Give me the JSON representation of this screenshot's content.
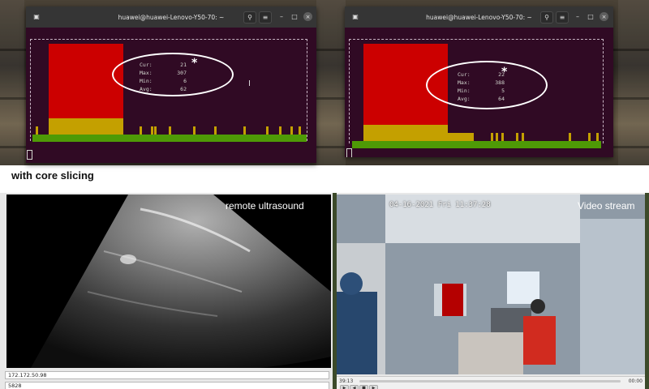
{
  "terminals": [
    {
      "title": "huawei@huawei-Lenovo-Y50-70: ~",
      "stats": {
        "cur_label": "Cur:",
        "cur": "21",
        "max_label": "Max:",
        "max": "307",
        "min_label": "Min:",
        "min": "6",
        "avg_label": "Avg:",
        "avg": "62"
      },
      "marker": "*"
    },
    {
      "title": "huawei@huawei-Lenovo-Y50-70: ~",
      "stats": {
        "cur_label": "Cur:",
        "cur": "22",
        "max_label": "Max:",
        "max": "388",
        "min_label": "Min:",
        "min": "5",
        "avg_label": "Avg:",
        "avg": "64"
      },
      "marker": "*"
    }
  ],
  "titlebar_icons": {
    "search": "🔍",
    "menu": "≡",
    "minimize": "–",
    "maximize": "□",
    "close": "×",
    "terminal": "▣"
  },
  "caption": "with core slicing",
  "ultrasound_panel": {
    "label": "remote ultrasound",
    "ip_field": "172.172.50.98",
    "port_field": "5828"
  },
  "video_panel": {
    "label": "Video stream",
    "timestamp": "04-16-2021 Fri 11:37:28",
    "elapsed": "39:13",
    "end_time": "00:00"
  },
  "colors": {
    "terminal_bg": "#300a24",
    "bar_red": "#cc0000",
    "bar_yellow": "#c4a000",
    "bar_green": "#4e9a06",
    "annotation": "#ffffff"
  }
}
